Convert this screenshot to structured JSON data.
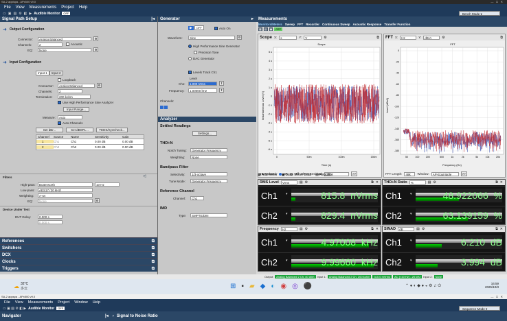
{
  "window": {
    "title": "SA-2 applspa - APx500 v9.0",
    "title2": "SA-2 appspa - APx500 v9.0"
  },
  "menu": [
    "File",
    "View",
    "Measurements",
    "Project",
    "Help"
  ],
  "menu2": [
    "File",
    "View",
    "Measurements",
    "Project",
    "Window",
    "Help"
  ],
  "toolbar": {
    "audible": "Audible Monitor",
    "off": "OFF",
    "bench": "Bench Mode",
    "sequence": "Sequence Mode"
  },
  "signal_path": {
    "title": "Signal Path Setup",
    "output_cfg": "Output Configuration",
    "connector_lbl": "Connector:",
    "connector": "Analog Balanced",
    "channels_lbl": "Channels:",
    "channels": "2",
    "acoustic": "Acoustic",
    "eq_lbl": "EQ:",
    "eq": "None",
    "input_cfg": "Input Configuration",
    "tabs": [
      "Input 1",
      "Input 2"
    ],
    "loopback": "Loopback",
    "in_connector": "Analog Balanced",
    "in_channels": "2",
    "termination_lbl": "Termination:",
    "termination": "200 kohm",
    "hp_sine": "Use High Performance Sine Analyzer",
    "input_range": "Input Range...",
    "measure_lbl": "Measure:",
    "measure": "Auto",
    "auto_channels": "Auto Channels",
    "set_dbr": "Set dBr...",
    "set_dbspl": "Set dBSPL...",
    "tedssync": "TEDS/SysCheck...",
    "table_headers": [
      "Channel",
      "Source",
      "Name",
      "Sensitivity",
      "Gain"
    ],
    "table_rows": [
      [
        "1",
        "Ch1",
        "Ch1",
        "0.00 dB",
        "0.00 dB"
      ],
      [
        "2",
        "Ch2",
        "Ch2",
        "0.00 dB",
        "0.00 dB"
      ]
    ],
    "filters": "Filters",
    "highpass_lbl": "High-pass:",
    "highpass": "Butterworth",
    "hp_freq": "10 Hz",
    "lowpass_lbl": "Low-pass:",
    "lowpass": "AES17 (20 kHz)",
    "weighting_lbl": "Weighting:",
    "weighting": "A-wt",
    "eq2_lbl": "EQ:",
    "eq2": "None",
    "dut": "Device Under Test",
    "dut_delay_lbl": "DUT Delay:",
    "dut_delay": "0.000 s",
    "dut_delay2": "0.000 s",
    "sections": [
      "References",
      "Switchers",
      "DCX",
      "Clocks",
      "Triggers"
    ]
  },
  "generator": {
    "title": "Generator",
    "off": "OFF",
    "auto_on": "Auto On",
    "waveform_lbl": "Waveform:",
    "waveform": "Sine",
    "hp_sine": "High Performance Sine Generator",
    "precision": "Precision Tone",
    "dac": "DAC Generator",
    "levels_track": "Levels Track Ch1",
    "level_lbl": "Level",
    "ch1_lbl": "Ch1:",
    "ch1": "1.000 Vrms",
    "freq_lbl": "Frequency:",
    "freq": "1.00000 kHz",
    "channels_lbl": "Channels:"
  },
  "analyzer": {
    "title": "Analyzer",
    "settled": "Settled Readings",
    "settings": "Settings...",
    "thdn": "THD+N",
    "notch_lbl": "Notch Tuning:",
    "notch": "Generator Frequency",
    "weighting_lbl": "Weighting:",
    "weighting": "None",
    "bandpass": "Bandpass Filter",
    "selectivity_lbl": "Selectivity:",
    "selectivity": "1/3-octave",
    "tune_lbl": "Tune Mode:",
    "tune": "Generator Frequency",
    "refch": "Reference Channel",
    "channel_lbl": "Channel:",
    "channel": "Ch1",
    "imd": "IMD",
    "type_lbl": "Type:",
    "type": "SMPTE/DIN"
  },
  "measurements": {
    "title": "Measurements",
    "tabs": [
      "Monitors/Meters",
      "Sweep",
      "FFT",
      "Recorder",
      "Continuous Sweep",
      "Acoustic Response",
      "Transfer Function"
    ],
    "off": "OFF"
  },
  "scope": {
    "title": "Scope",
    "x_lbl": "X:",
    "x": "s",
    "y_lbl": "Y:",
    "y": "V",
    "plot_title": "Scope",
    "ylabel": "Instantaneous Level (V)",
    "xlabel": "Time (s)",
    "yticks": [
      "5 u",
      "4 u",
      "3 u",
      "2 u",
      "1 u",
      "0",
      "-1 u",
      "-2 u",
      "-3 u",
      "-4 u",
      "-5 u",
      "-6 u"
    ],
    "xticks": [
      "0",
      "50m",
      "100m",
      "150m"
    ],
    "interpolated": "Interpolated:",
    "on": "On",
    "off": "Off",
    "show_residual": "Show Residual:",
    "residual": "Off"
  },
  "fft": {
    "title": "FFT",
    "x_lbl": "X:",
    "x": "Hz",
    "y_lbl": "Y:",
    "y": "dBrA",
    "plot_title": "FFT",
    "ylabel": "Level (dBrA)",
    "xlabel": "Frequency (Hz)",
    "yticks": [
      "0",
      "-20",
      "-40",
      "-60",
      "-80",
      "-100",
      "-120",
      "-140",
      "-160",
      "-180"
    ],
    "xticks": [
      "50",
      "100",
      "200",
      "500",
      "1k",
      "2k",
      "5k",
      "10k",
      "20k"
    ],
    "length_lbl": "FFT Length:",
    "length": "48k",
    "window_lbl": "Window:",
    "window": "AP-Equiripple"
  },
  "meter_toolbar": {
    "add": "Add Meter",
    "save": "Save Meter Data",
    "regulate": "Regulate"
  },
  "meters": [
    {
      "name": "RMS Level",
      "unit_sel": "Vrms",
      "ch": [
        {
          "label": "Ch1",
          "value": "815.8",
          "unit": "nVrms",
          "fill": 0.05
        },
        {
          "label": "Ch2",
          "value": "829.4",
          "unit": "nVrms",
          "fill": 0.05
        }
      ]
    },
    {
      "name": "THD+N Ratio",
      "unit_sel": "%",
      "ch": [
        {
          "label": "Ch1",
          "value": "48.922066",
          "unit": "%",
          "fill": 0.5
        },
        {
          "label": "Ch2",
          "value": "63.139159",
          "unit": "%",
          "fill": 0.6
        }
      ]
    },
    {
      "name": "Frequency",
      "unit_sel": "Hz",
      "ch": [
        {
          "label": "Ch1",
          "value": "4.97008",
          "unit": "kHz",
          "fill": 0.9
        },
        {
          "label": "Ch2",
          "value": "9.99660",
          "unit": "kHz",
          "fill": 0.95
        }
      ]
    },
    {
      "name": "SINAD",
      "unit_sel": "dB",
      "ch": [
        {
          "label": "Ch1",
          "value": "6.210",
          "unit": "dB",
          "fill": 0.3
        },
        {
          "label": "Ch2",
          "value": "3.994",
          "unit": "dB",
          "fill": 0.25
        }
      ]
    }
  ],
  "status": {
    "output_lbl": "Output:",
    "output": "Analog Balanced 2 Ch, 40 ohm",
    "input1_lbl": "Input 1:",
    "input1": "Analog Balanced 2 Ch, 200 kohm",
    "range": "310.0 mVrms",
    "ac": "AC (<10 Hz) - 20 kHz",
    "input2_lbl": "Input 2:",
    "input2": "None"
  },
  "taskbar": {
    "temp": "32°C",
    "weather": "多云",
    "time": "16:59",
    "date": "2025/10/3"
  },
  "navigator": {
    "title": "Navigator",
    "item": "Signal to Noise Ratio"
  },
  "colors": {
    "accent": "#1f3a5a",
    "meter_green": "#8dff8d",
    "trace_red": "#c0282e",
    "trace_blue": "#3a52b0"
  }
}
